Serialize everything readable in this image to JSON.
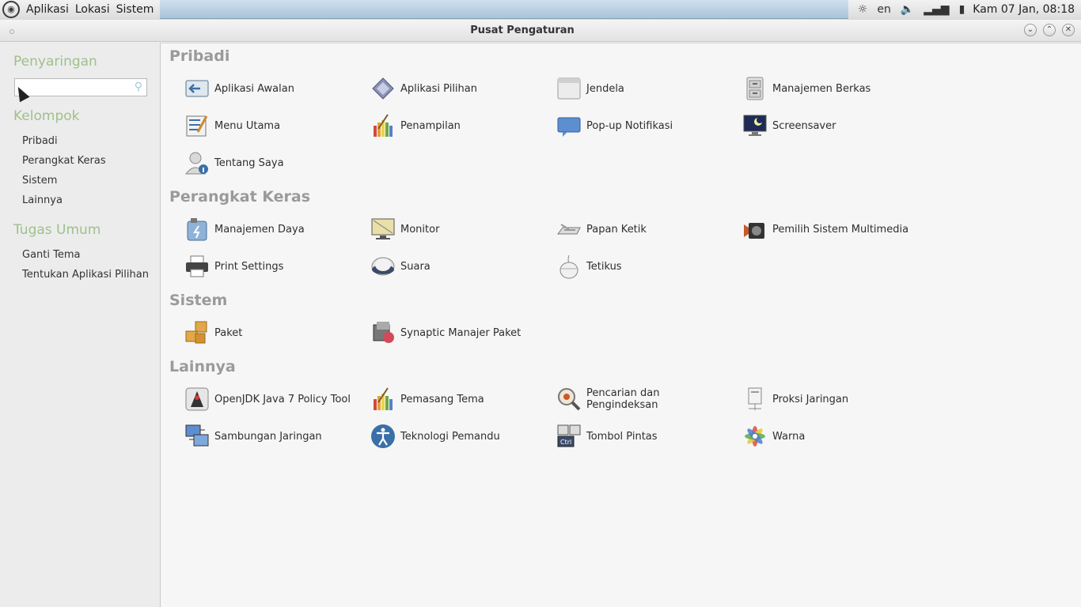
{
  "panel": {
    "menus": [
      "Aplikasi",
      "Lokasi",
      "Sistem"
    ],
    "tray": {
      "keyboard_layout": "en",
      "clock": "Kam 07 Jan, 08:18"
    }
  },
  "window": {
    "title": "Pusat Pengaturan"
  },
  "sidebar": {
    "filter_heading": "Penyaringan",
    "search_placeholder": "",
    "groups_heading": "Kelompok",
    "groups": [
      "Pribadi",
      "Perangkat Keras",
      "Sistem",
      "Lainnya"
    ],
    "tasks_heading": "Tugas Umum",
    "tasks": [
      "Ganti Tema",
      "Tentukan Aplikasi Pilihan"
    ]
  },
  "sections": [
    {
      "title": "Pribadi",
      "items": [
        {
          "label": "Aplikasi Awalan",
          "icon": "startup-apps-icon"
        },
        {
          "label": "Aplikasi Pilihan",
          "icon": "preferred-apps-icon"
        },
        {
          "label": "Jendela",
          "icon": "window-icon"
        },
        {
          "label": "Manajemen Berkas",
          "icon": "file-cabinet-icon"
        },
        {
          "label": "Menu Utama",
          "icon": "main-menu-icon"
        },
        {
          "label": "Penampilan",
          "icon": "appearance-icon"
        },
        {
          "label": "Pop-up Notifikasi",
          "icon": "notification-icon"
        },
        {
          "label": "Screensaver",
          "icon": "screensaver-icon"
        },
        {
          "label": "Tentang Saya",
          "icon": "about-me-icon"
        }
      ]
    },
    {
      "title": "Perangkat Keras",
      "items": [
        {
          "label": "Manajemen Daya",
          "icon": "power-icon"
        },
        {
          "label": "Monitor",
          "icon": "monitor-icon"
        },
        {
          "label": "Papan Ketik",
          "icon": "keyboard-icon"
        },
        {
          "label": "Pemilih Sistem Multimedia",
          "icon": "multimedia-icon"
        },
        {
          "label": "Print Settings",
          "icon": "printer-icon"
        },
        {
          "label": "Suara",
          "icon": "sound-icon"
        },
        {
          "label": "Tetikus",
          "icon": "mouse-icon"
        }
      ]
    },
    {
      "title": "Sistem",
      "items": [
        {
          "label": "Paket",
          "icon": "package-icon"
        },
        {
          "label": "Synaptic Manajer Paket",
          "icon": "synaptic-icon"
        }
      ]
    },
    {
      "title": "Lainnya",
      "items": [
        {
          "label": "OpenJDK Java 7 Policy Tool",
          "icon": "java-icon"
        },
        {
          "label": "Pemasang Tema",
          "icon": "theme-installer-icon"
        },
        {
          "label": "Pencarian dan Pengindeksan",
          "icon": "search-index-icon"
        },
        {
          "label": "Proksi Jaringan",
          "icon": "proxy-icon"
        },
        {
          "label": "Sambungan Jaringan",
          "icon": "network-icon"
        },
        {
          "label": "Teknologi Pemandu",
          "icon": "accessibility-icon"
        },
        {
          "label": "Tombol Pintas",
          "icon": "shortcuts-icon"
        },
        {
          "label": "Warna",
          "icon": "color-icon"
        }
      ]
    }
  ],
  "colors": {
    "heading_green": "#9fc08a",
    "section_gray": "#9a9a9a"
  }
}
